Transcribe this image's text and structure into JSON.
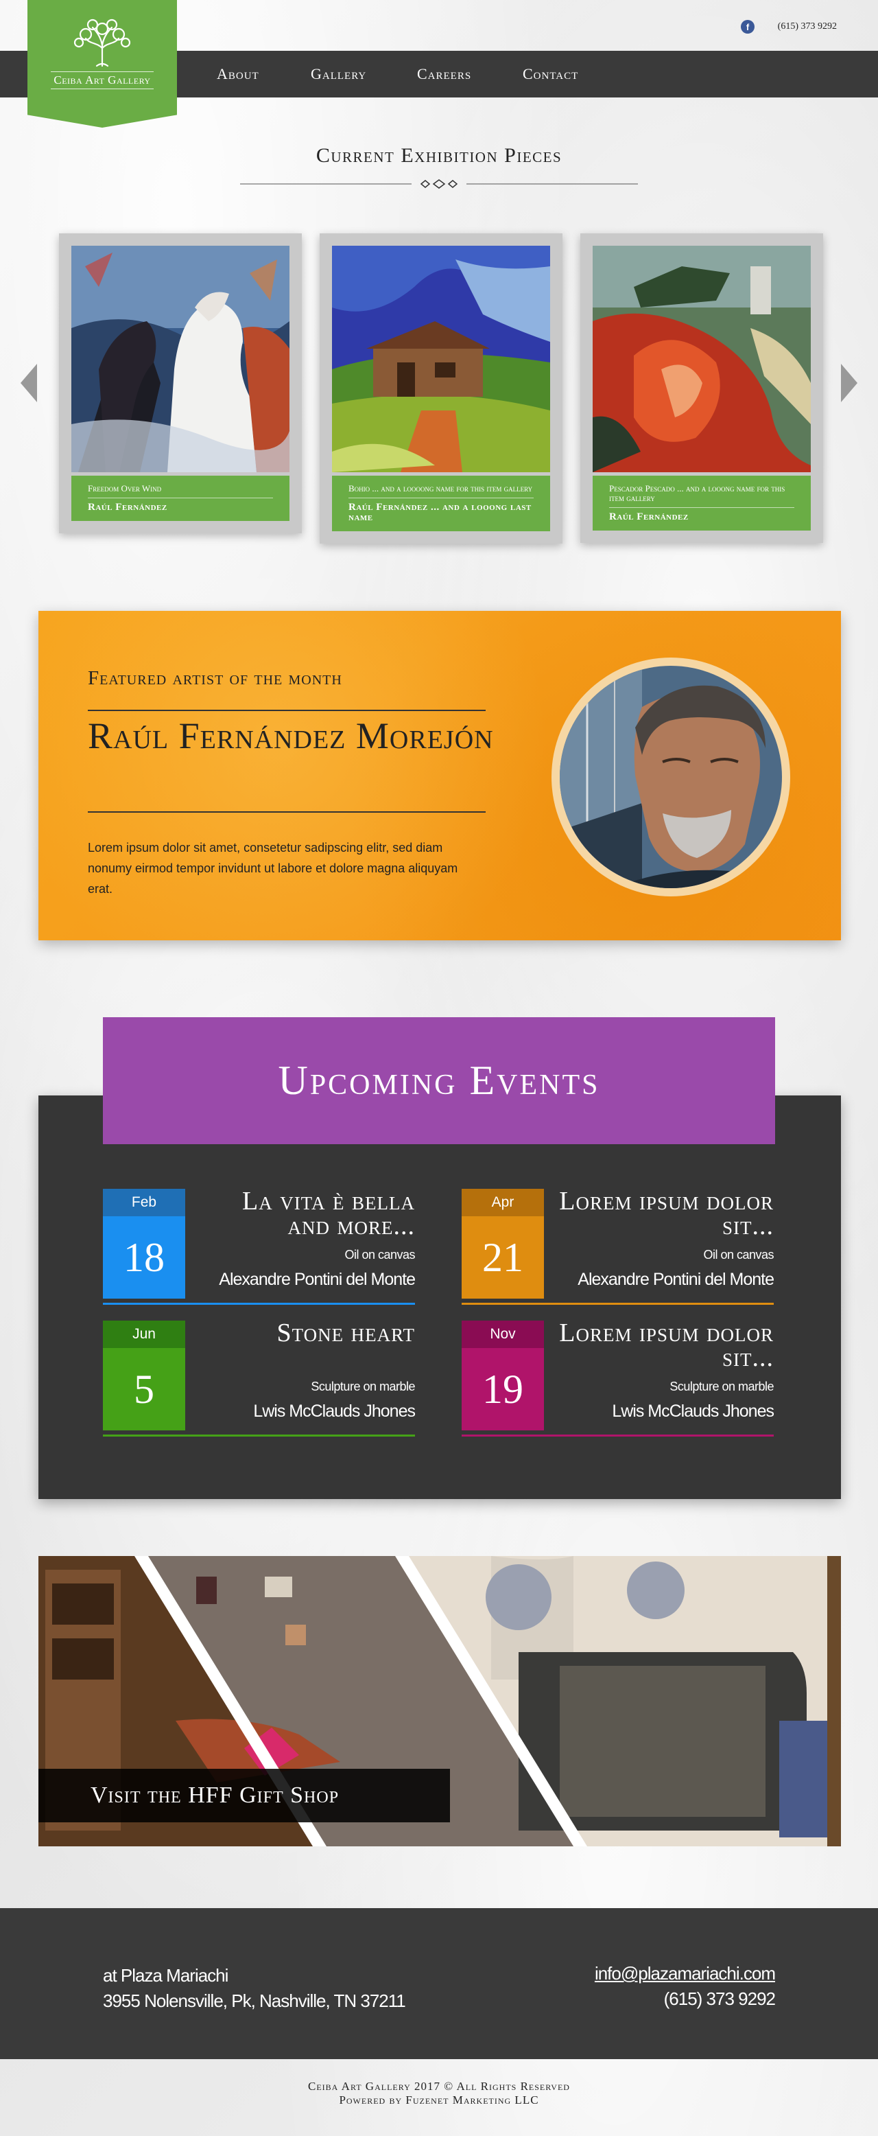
{
  "topbar": {
    "phone": "(615) 373 9292",
    "facebook_icon": "facebook-icon",
    "facebook_glyph": "f"
  },
  "logo": {
    "name": "Ceiba Art Gallery",
    "icon": "tree-icon",
    "color": "#6aad45"
  },
  "nav": {
    "items": [
      "About",
      "Gallery",
      "Careers",
      "Contact"
    ]
  },
  "exhibition": {
    "title": "Current Exhibition Pieces",
    "pieces": [
      {
        "title": "Freedom Over Wind",
        "artist": "Raúl Fernández"
      },
      {
        "title": "Bohio ... and a loooong name for this item gallery",
        "artist": "Raúl Fernández ... and a looong last name"
      },
      {
        "title": "Pescador Pescado ... and a looong name for this item gallery",
        "artist": "Raúl Fernández"
      }
    ],
    "prev_icon": "arrow-left-icon",
    "next_icon": "arrow-right-icon"
  },
  "featured": {
    "label": "Featured artist of the month",
    "name": "Raúl Fernández Morejón",
    "text": "Lorem ipsum dolor sit amet, consetetur sadipscing elitr, sed diam nonumy eirmod tempor invidunt ut labore et dolore magna aliquyam erat.",
    "color": "#f59c1a"
  },
  "events": {
    "title": "Upcoming Events",
    "header_color": "#9a4aaa",
    "items": [
      {
        "month": "Feb",
        "day": "18",
        "title": "La vita è bella and more...",
        "medium": "Oil on canvas",
        "artist": "Alexandre Pontini del Monte",
        "color_dark": "#1f6fb5",
        "color": "#1a8ff0"
      },
      {
        "month": "Apr",
        "day": "21",
        "title": "Lorem ipsum dolor sit...",
        "medium": "Oil on canvas",
        "artist": "Alexandre Pontini del Monte",
        "color_dark": "#b5700c",
        "color": "#df8d10"
      },
      {
        "month": "Jun",
        "day": "5",
        "title": "Stone heart",
        "medium": "Sculpture on marble",
        "artist": "Lwis McClauds Jhones",
        "color_dark": "#2f7f12",
        "color": "#45a117"
      },
      {
        "month": "Nov",
        "day": "19",
        "title": "Lorem ipsum dolor sit...",
        "medium": "Sculpture on marble",
        "artist": "Lwis McClauds Jhones",
        "color_dark": "#8a0c53",
        "color": "#b0146a"
      }
    ]
  },
  "giftshop": {
    "label": "Visit the HFF Gift Shop"
  },
  "footer": {
    "location": "at Plaza Mariachi",
    "address": "3955 Nolensville, Pk, Nashville, TN 37211",
    "email": "info@plazamariachi.com",
    "phone": "(615) 373 9292",
    "copyright": "Ceiba Art Gallery 2017 © All Rights Reserved",
    "powered_by": "Powered by Fuzenet Marketing LLC"
  }
}
